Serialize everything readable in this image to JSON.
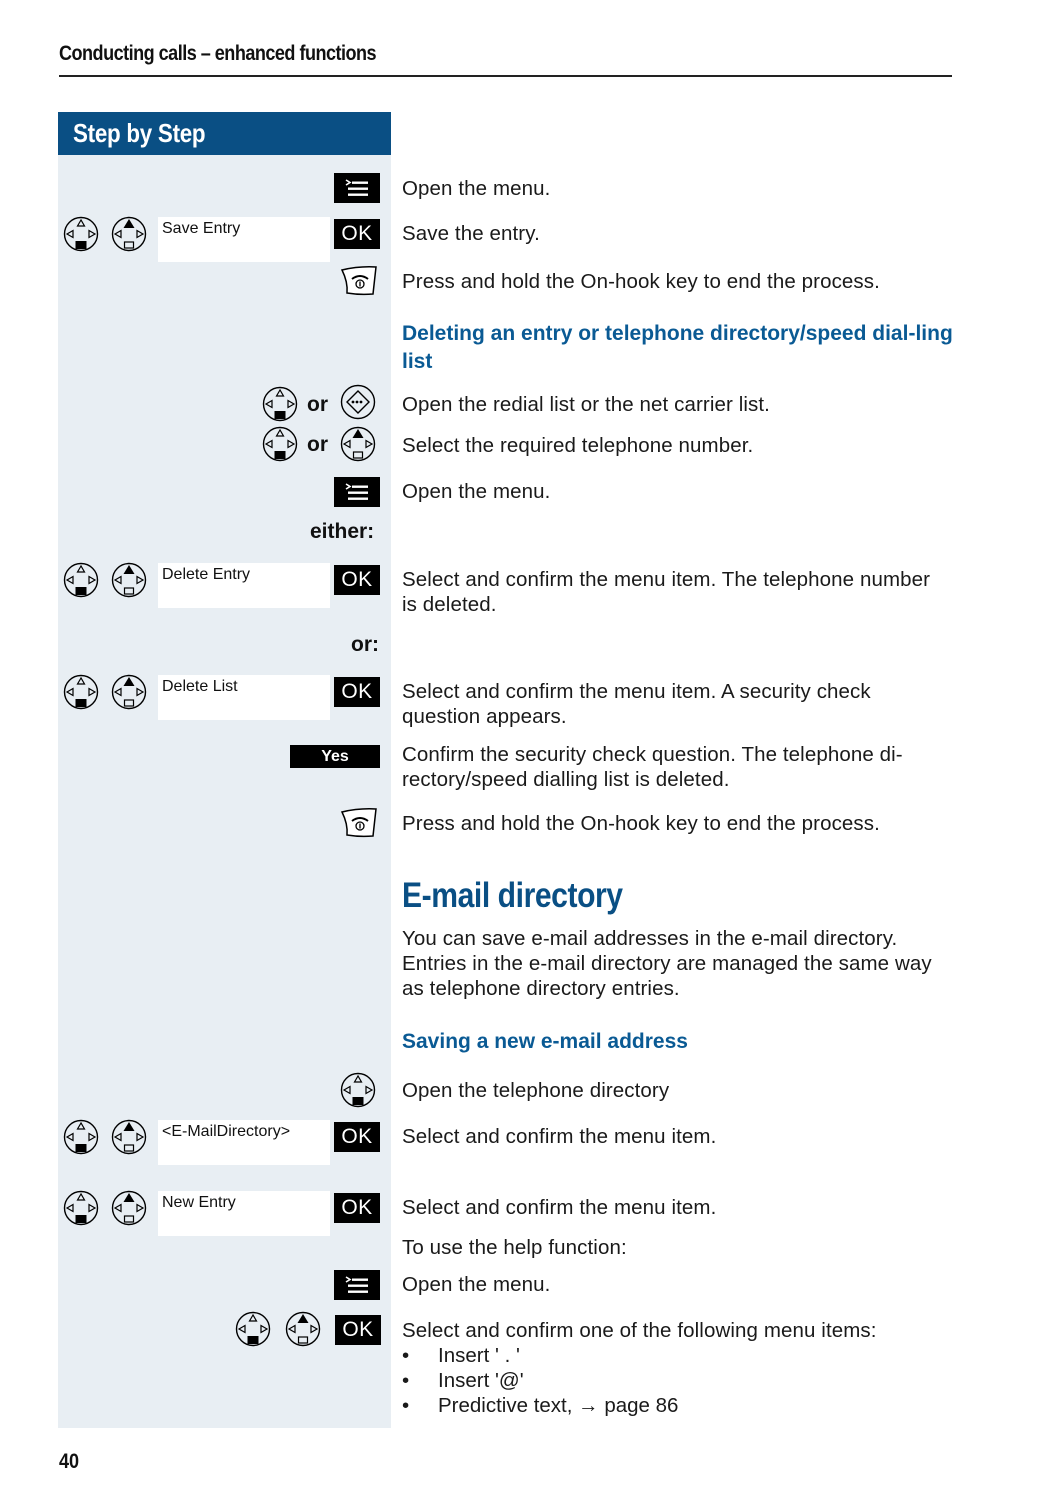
{
  "header": {
    "title": "Conducting calls – enhanced functions"
  },
  "panel": {
    "title": "Step by Step"
  },
  "keys": {
    "ok": "OK",
    "yes": "Yes",
    "or": "or"
  },
  "steps": {
    "open_menu_1": "Open the menu.",
    "save_entry_display": "Save Entry",
    "save_entry": "Save the entry.",
    "onhook_1": "Press and hold the On-hook key to end the process.",
    "delete_heading": "Deleting an entry or telephone directory/speed dial-ling list",
    "open_redial": "Open the redial list or the net carrier list.",
    "select_number": "Select the required telephone number.",
    "open_menu_2": "Open the menu.",
    "either": "either:",
    "delete_entry_display": "Delete Entry",
    "delete_entry": "Select and confirm the menu item. The telephone number is deleted.",
    "or_label": "or:",
    "delete_list_display": "Delete List",
    "delete_list": "Select and confirm the menu item. A security check question appears.",
    "confirm_security": "Confirm the security check question. The telephone di-rectory/speed dialling list is deleted.",
    "onhook_2": "Press and hold the On-hook key to end the process."
  },
  "email": {
    "title": "E-mail directory",
    "intro": "You can save e-mail addresses in the e-mail directory. Entries in the e-mail directory are managed the same way as telephone directory entries.",
    "subheading": "Saving a new e-mail address",
    "open_directory": "Open the telephone directory",
    "email_dir_display": "<E-MailDirectory>",
    "email_dir_step": "Select and confirm the menu item.",
    "new_entry_display": "New Entry",
    "new_entry_step": "Select and confirm the menu item.",
    "help_intro": "To use the help function:",
    "open_menu_3": "Open the menu.",
    "select_one": "Select and confirm one of the following menu items:",
    "items": [
      "Insert ' . '",
      "Insert '@'",
      "Predictive text, → page 86"
    ]
  },
  "footer": {
    "page_number": "40"
  }
}
